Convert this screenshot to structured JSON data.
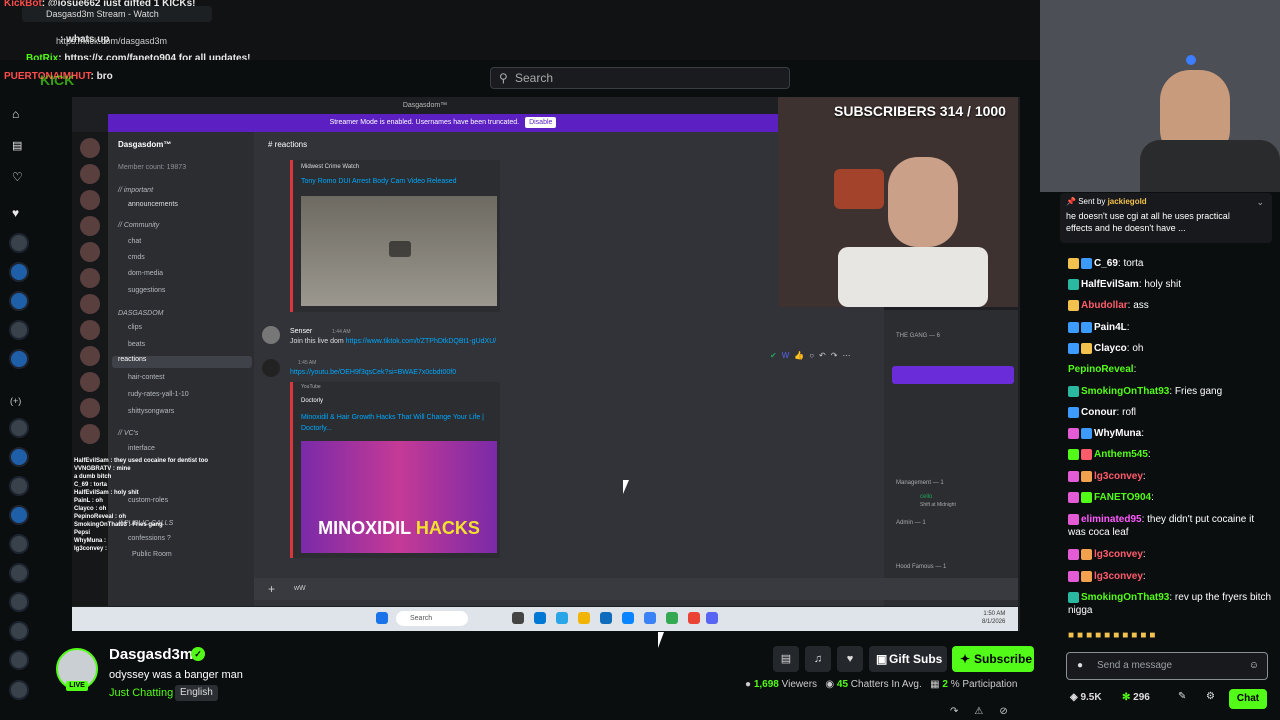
{
  "browser": {
    "tab_title": "Dasgasd3m Stream - Watch",
    "url": "https://kick.com/dasgasd3m"
  },
  "top_overlay_chat": [
    {
      "user": "KickBot",
      "text": ": @josue662 just gifted 1 KICKs!"
    },
    {
      "user": "",
      "text": ": whats up"
    },
    {
      "user": "BotRix",
      "text": ": https://x.com/faneto904 for all updates!"
    },
    {
      "user": "PUERTONAIMHUT",
      "text": ": bro"
    }
  ],
  "search": {
    "placeholder": "Search"
  },
  "video": {
    "subscriber_goal": "SUBSCRIBERS 314 / 1000",
    "discord": {
      "window_title": "Dasgasdom™",
      "streamer_banner": "Streamer Mode is enabled. Usernames have been truncated.",
      "disable_label": "Disable",
      "server_name": "Dasgasdom™",
      "member_count": "Member count: 19873",
      "current_channel": "reactions",
      "channels": [
        "// important",
        "announcements",
        "// Community",
        "chat",
        "cmds",
        "dom-media",
        "suggestions",
        "DASGASDOM",
        "clips",
        "beats",
        "reactions",
        "hair-contest",
        "rudy-rates-yall-1-10",
        "shittysongwars",
        "// VC's",
        "interface",
        "custom-roles",
        "// PUBLIC CALLS",
        "confessions ?",
        "Public Room"
      ],
      "embed1": {
        "provider": "Midwest Crime Watch",
        "title": "Tony Romo DUI Arrest Body Cam Video Released"
      },
      "message1": {
        "author": "Senser",
        "time": "1:44 AM",
        "text": "Join this live dom",
        "link": "https://www.tiktok.com/t/ZTPhDtkDQBt1-gUdXU/"
      },
      "message2": {
        "time": "1:45 AM",
        "link": "https://youtu.be/OEH9f3qsCek?si=BWAE7x0cbdt00f0"
      },
      "embed2": {
        "provider": "YouTube",
        "channel": "Doctorly",
        "title": "Minoxidil & Hair Growth Hacks That Will Change Your Life | Doctorly...",
        "thumb_text_1": "MINOXIDIL",
        "thumb_text_2": "HACKS"
      },
      "input_text": "wW",
      "members_header": "THE GANG — 6",
      "members_management": "Management — 1",
      "member_cello": "cello",
      "member_cello_status": "Shift at Midnight",
      "members_admin": "Admin — 1",
      "members_hood": "Hood Famous — 1"
    },
    "taskbar": {
      "search_label": "Search",
      "time": "1:50 AM",
      "date": "8/1/2026"
    },
    "overlay_chat": [
      "HalfEvilSam : they used cocaine for dentist too",
      "VVNGBRATV : mine",
      "a dumb bitch",
      "C_69 : torta",
      "HalfEvilSam : holy shit",
      "PainL : oh",
      "Clayco : oh",
      "PepinoReveal : oh",
      "SmokingOnThat93 : Fries gang",
      "Pepsi",
      "WhyMuna :",
      "Ig3convey :"
    ]
  },
  "channel": {
    "name": "Dasgasd3m",
    "live_label": "LIVE",
    "title": "odyssey was a banger man",
    "category": "Just Chatting",
    "language": "English",
    "viewers": "1,698",
    "viewers_label": "Viewers",
    "chatters": "45",
    "chatters_label": "Chatters In Avg.",
    "participation": "2",
    "participation_label": "% Participation",
    "gift_subs_label": "Gift Subs",
    "subscribe_label": "Subscribe"
  },
  "chat": {
    "pinned_sent_by_label": "Sent by",
    "pinned_sender": "jackiegold",
    "pinned_text": "he doesn't use cgi at all he uses practical effects and he doesn't have ...",
    "messages": [
      {
        "user": "C_69",
        "color": "#f3f3f3",
        "text": "torta"
      },
      {
        "user": "HalfEvilSam",
        "color": "#f3f3f3",
        "text": "holy shit"
      },
      {
        "user": "Abudollar",
        "color": "#ff5b6b",
        "text": "ass"
      },
      {
        "user": "Pain4L",
        "color": "#f3f3f3",
        "text": ""
      },
      {
        "user": "Clayco",
        "color": "#f3f3f3",
        "text": "oh"
      },
      {
        "user": "PepinoReveal",
        "color": "#53fc18",
        "text": ""
      },
      {
        "user": "SmokingOnThat93",
        "color": "#53fc18",
        "text": "Fries gang"
      },
      {
        "user": "Conour",
        "color": "#f3f3f3",
        "text": "rofl"
      },
      {
        "user": "WhyMuna",
        "color": "#f3f3f3",
        "text": ""
      },
      {
        "user": "Anthem545",
        "color": "#53fc18",
        "text": ""
      },
      {
        "user": "lg3convey",
        "color": "#ff5b6b",
        "text": ""
      },
      {
        "user": "FANETO904",
        "color": "#53fc18",
        "text": ""
      },
      {
        "user": "eliminated95",
        "color": "#ff5bff",
        "text": "they didn't put cocaine it was coca leaf"
      },
      {
        "user": "lg3convey",
        "color": "#ff5b6b",
        "text": ""
      },
      {
        "user": "lg3convey",
        "color": "#ff5b6b",
        "text": ""
      },
      {
        "user": "SmokingOnThat93",
        "color": "#53fc18",
        "text": "rev up the fryers bitch nigga"
      }
    ],
    "input_placeholder": "Send a message",
    "kicks_count": "9.5K",
    "points_count": "296",
    "chat_button": "Chat"
  },
  "colors": {
    "accent": "#53fc18",
    "discord_purple": "#5b1fc2",
    "bg": "#0b0e0f"
  }
}
